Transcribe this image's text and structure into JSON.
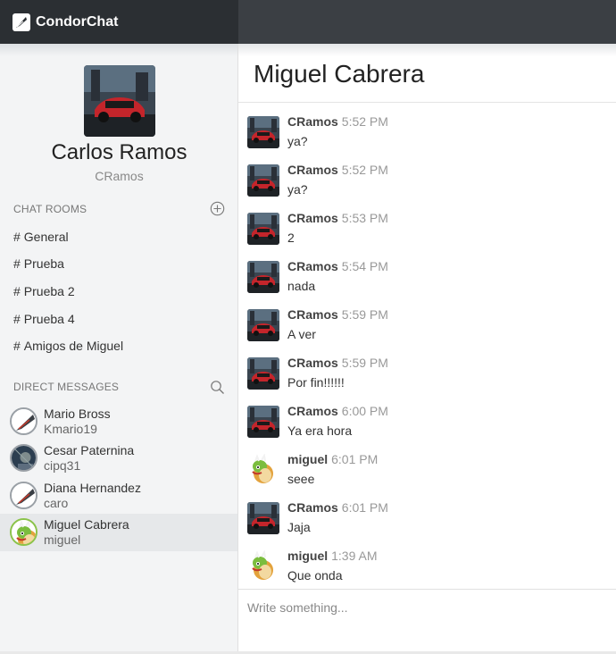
{
  "app": {
    "brand": "CondorChat"
  },
  "profile": {
    "name": "Carlos Ramos",
    "username": "CRamos"
  },
  "chat_rooms": {
    "title": "CHAT ROOMS",
    "items": [
      {
        "label": "General"
      },
      {
        "label": "Prueba"
      },
      {
        "label": "Prueba 2"
      },
      {
        "label": "Prueba 4"
      },
      {
        "label": "Amigos de Miguel"
      }
    ]
  },
  "direct_messages": {
    "title": "DIRECT MESSAGES",
    "items": [
      {
        "name": "Mario Bross",
        "username": "Kmario19",
        "avatar": "bird",
        "active": false
      },
      {
        "name": "Cesar Paternina",
        "username": "cipq31",
        "avatar": "dark",
        "active": false
      },
      {
        "name": "Diana Hernandez",
        "username": "caro",
        "avatar": "bird",
        "active": false
      },
      {
        "name": "Miguel Cabrera",
        "username": "miguel",
        "avatar": "bowser",
        "active": true
      }
    ]
  },
  "chat": {
    "title": "Miguel Cabrera",
    "messages": [
      {
        "author": "CRamos",
        "time": "5:52 PM",
        "text": "ya?",
        "avatar": "car"
      },
      {
        "author": "CRamos",
        "time": "5:52 PM",
        "text": "ya?",
        "avatar": "car"
      },
      {
        "author": "CRamos",
        "time": "5:53 PM",
        "text": "2",
        "avatar": "car"
      },
      {
        "author": "CRamos",
        "time": "5:54 PM",
        "text": "nada",
        "avatar": "car"
      },
      {
        "author": "CRamos",
        "time": "5:59 PM",
        "text": "A ver",
        "avatar": "car"
      },
      {
        "author": "CRamos",
        "time": "5:59 PM",
        "text": "Por fin!!!!!!",
        "avatar": "car"
      },
      {
        "author": "CRamos",
        "time": "6:00 PM",
        "text": "Ya era hora",
        "avatar": "car"
      },
      {
        "author": "miguel",
        "time": "6:01 PM",
        "text": "seee",
        "avatar": "bowser"
      },
      {
        "author": "CRamos",
        "time": "6:01 PM",
        "text": "Jaja",
        "avatar": "car"
      },
      {
        "author": "miguel",
        "time": "1:39 AM",
        "text": "Que onda",
        "avatar": "bowser"
      }
    ]
  },
  "composer": {
    "placeholder": "Write something..."
  },
  "colors": {
    "topbar": "#2b2f33",
    "sidebar": "#f3f4f5",
    "active_row": "#e6e8ea"
  }
}
